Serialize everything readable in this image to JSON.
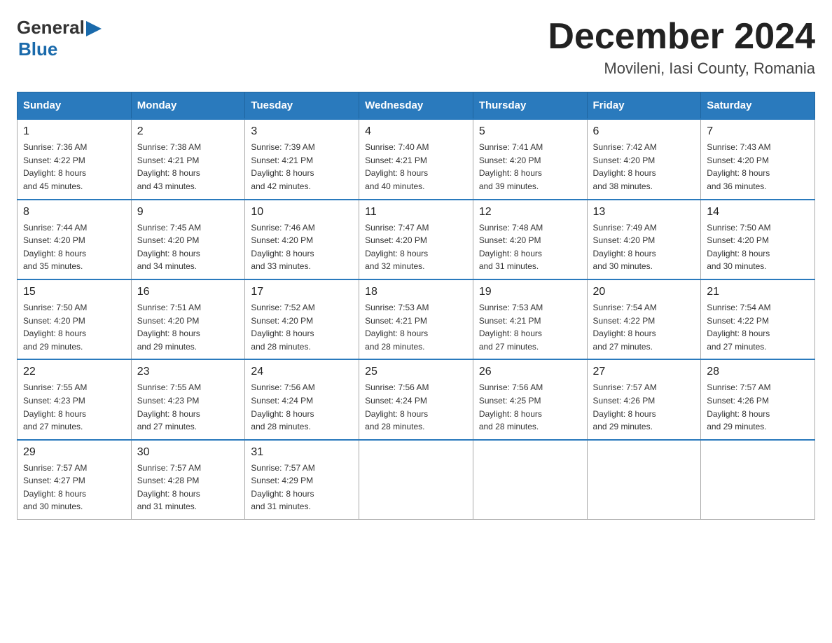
{
  "header": {
    "logo_line1": "General",
    "logo_line2": "Blue",
    "month_title": "December 2024",
    "location": "Movileni, Iasi County, Romania"
  },
  "calendar": {
    "days_of_week": [
      "Sunday",
      "Monday",
      "Tuesday",
      "Wednesday",
      "Thursday",
      "Friday",
      "Saturday"
    ],
    "weeks": [
      [
        {
          "day": "1",
          "sunrise": "7:36 AM",
          "sunset": "4:22 PM",
          "daylight": "8 hours and 45 minutes."
        },
        {
          "day": "2",
          "sunrise": "7:38 AM",
          "sunset": "4:21 PM",
          "daylight": "8 hours and 43 minutes."
        },
        {
          "day": "3",
          "sunrise": "7:39 AM",
          "sunset": "4:21 PM",
          "daylight": "8 hours and 42 minutes."
        },
        {
          "day": "4",
          "sunrise": "7:40 AM",
          "sunset": "4:21 PM",
          "daylight": "8 hours and 40 minutes."
        },
        {
          "day": "5",
          "sunrise": "7:41 AM",
          "sunset": "4:20 PM",
          "daylight": "8 hours and 39 minutes."
        },
        {
          "day": "6",
          "sunrise": "7:42 AM",
          "sunset": "4:20 PM",
          "daylight": "8 hours and 38 minutes."
        },
        {
          "day": "7",
          "sunrise": "7:43 AM",
          "sunset": "4:20 PM",
          "daylight": "8 hours and 36 minutes."
        }
      ],
      [
        {
          "day": "8",
          "sunrise": "7:44 AM",
          "sunset": "4:20 PM",
          "daylight": "8 hours and 35 minutes."
        },
        {
          "day": "9",
          "sunrise": "7:45 AM",
          "sunset": "4:20 PM",
          "daylight": "8 hours and 34 minutes."
        },
        {
          "day": "10",
          "sunrise": "7:46 AM",
          "sunset": "4:20 PM",
          "daylight": "8 hours and 33 minutes."
        },
        {
          "day": "11",
          "sunrise": "7:47 AM",
          "sunset": "4:20 PM",
          "daylight": "8 hours and 32 minutes."
        },
        {
          "day": "12",
          "sunrise": "7:48 AM",
          "sunset": "4:20 PM",
          "daylight": "8 hours and 31 minutes."
        },
        {
          "day": "13",
          "sunrise": "7:49 AM",
          "sunset": "4:20 PM",
          "daylight": "8 hours and 30 minutes."
        },
        {
          "day": "14",
          "sunrise": "7:50 AM",
          "sunset": "4:20 PM",
          "daylight": "8 hours and 30 minutes."
        }
      ],
      [
        {
          "day": "15",
          "sunrise": "7:50 AM",
          "sunset": "4:20 PM",
          "daylight": "8 hours and 29 minutes."
        },
        {
          "day": "16",
          "sunrise": "7:51 AM",
          "sunset": "4:20 PM",
          "daylight": "8 hours and 29 minutes."
        },
        {
          "day": "17",
          "sunrise": "7:52 AM",
          "sunset": "4:20 PM",
          "daylight": "8 hours and 28 minutes."
        },
        {
          "day": "18",
          "sunrise": "7:53 AM",
          "sunset": "4:21 PM",
          "daylight": "8 hours and 28 minutes."
        },
        {
          "day": "19",
          "sunrise": "7:53 AM",
          "sunset": "4:21 PM",
          "daylight": "8 hours and 27 minutes."
        },
        {
          "day": "20",
          "sunrise": "7:54 AM",
          "sunset": "4:22 PM",
          "daylight": "8 hours and 27 minutes."
        },
        {
          "day": "21",
          "sunrise": "7:54 AM",
          "sunset": "4:22 PM",
          "daylight": "8 hours and 27 minutes."
        }
      ],
      [
        {
          "day": "22",
          "sunrise": "7:55 AM",
          "sunset": "4:23 PM",
          "daylight": "8 hours and 27 minutes."
        },
        {
          "day": "23",
          "sunrise": "7:55 AM",
          "sunset": "4:23 PM",
          "daylight": "8 hours and 27 minutes."
        },
        {
          "day": "24",
          "sunrise": "7:56 AM",
          "sunset": "4:24 PM",
          "daylight": "8 hours and 28 minutes."
        },
        {
          "day": "25",
          "sunrise": "7:56 AM",
          "sunset": "4:24 PM",
          "daylight": "8 hours and 28 minutes."
        },
        {
          "day": "26",
          "sunrise": "7:56 AM",
          "sunset": "4:25 PM",
          "daylight": "8 hours and 28 minutes."
        },
        {
          "day": "27",
          "sunrise": "7:57 AM",
          "sunset": "4:26 PM",
          "daylight": "8 hours and 29 minutes."
        },
        {
          "day": "28",
          "sunrise": "7:57 AM",
          "sunset": "4:26 PM",
          "daylight": "8 hours and 29 minutes."
        }
      ],
      [
        {
          "day": "29",
          "sunrise": "7:57 AM",
          "sunset": "4:27 PM",
          "daylight": "8 hours and 30 minutes."
        },
        {
          "day": "30",
          "sunrise": "7:57 AM",
          "sunset": "4:28 PM",
          "daylight": "8 hours and 31 minutes."
        },
        {
          "day": "31",
          "sunrise": "7:57 AM",
          "sunset": "4:29 PM",
          "daylight": "8 hours and 31 minutes."
        },
        null,
        null,
        null,
        null
      ]
    ],
    "labels": {
      "sunrise": "Sunrise: ",
      "sunset": "Sunset: ",
      "daylight": "Daylight: "
    }
  }
}
